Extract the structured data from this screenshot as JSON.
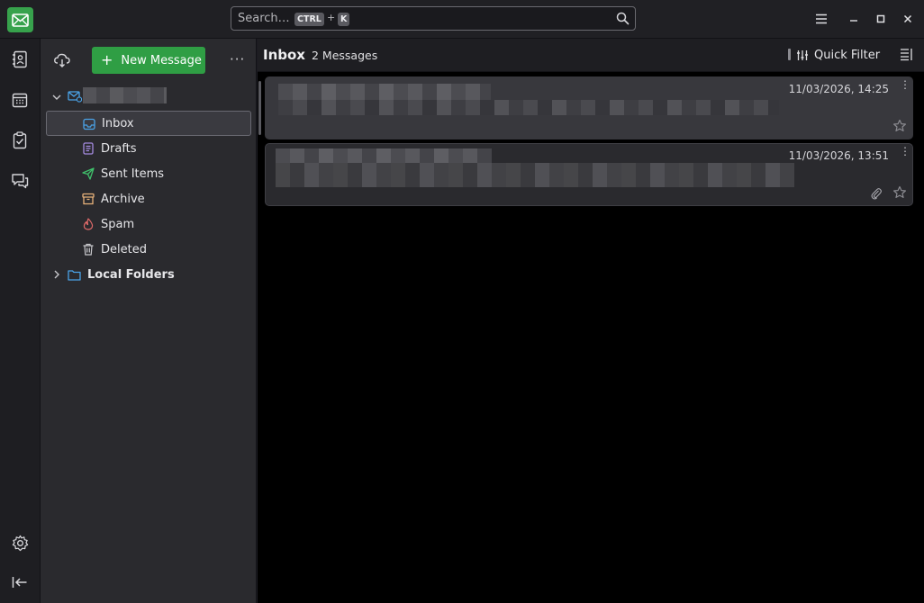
{
  "search": {
    "placeholder": "Search…",
    "shortcut_ctrl": "CTRL",
    "shortcut_plus": "+",
    "shortcut_key": "K"
  },
  "colors": {
    "accent_green": "#2f9e44",
    "logo_green": "#37a24c",
    "inbox_blue": "#4aa3e8",
    "drafts_purple": "#a58be0",
    "sent_green": "#3fbf6a",
    "archive_orange": "#e8b27a",
    "spam_red": "#e06a6a",
    "folder_blue": "#4aa3e8"
  },
  "spaces": {
    "items": [
      {
        "name": "mail",
        "icon": "envelope-icon"
      },
      {
        "name": "address-book",
        "icon": "address-book-icon"
      },
      {
        "name": "calendar",
        "icon": "calendar-icon"
      },
      {
        "name": "tasks",
        "icon": "clipboard-check-icon"
      },
      {
        "name": "chat",
        "icon": "chat-bubbles-icon"
      }
    ],
    "settings_icon": "gear-icon",
    "collapse_icon": "collapse-left-icon"
  },
  "folder_pane": {
    "new_message_label": "New Message",
    "more_label": "···",
    "folders": [
      {
        "label": "Inbox",
        "icon": "inbox-icon",
        "selected": true
      },
      {
        "label": "Drafts",
        "icon": "drafts-icon",
        "selected": false
      },
      {
        "label": "Sent Items",
        "icon": "send-icon",
        "selected": false
      },
      {
        "label": "Archive",
        "icon": "archive-icon",
        "selected": false
      },
      {
        "label": "Spam",
        "icon": "spam-flame-icon",
        "selected": false
      },
      {
        "label": "Deleted",
        "icon": "trash-icon",
        "selected": false
      }
    ],
    "local_folders_label": "Local Folders"
  },
  "thread_pane": {
    "folder_title": "Inbox",
    "message_count": "2 Messages",
    "quick_filter_label": "Quick Filter",
    "messages": [
      {
        "date": "11/03/2026, 14:25",
        "starred": false,
        "has_attachment": false,
        "selected": true
      },
      {
        "date": "11/03/2026, 13:51",
        "starred": false,
        "has_attachment": true,
        "selected": false
      }
    ]
  }
}
